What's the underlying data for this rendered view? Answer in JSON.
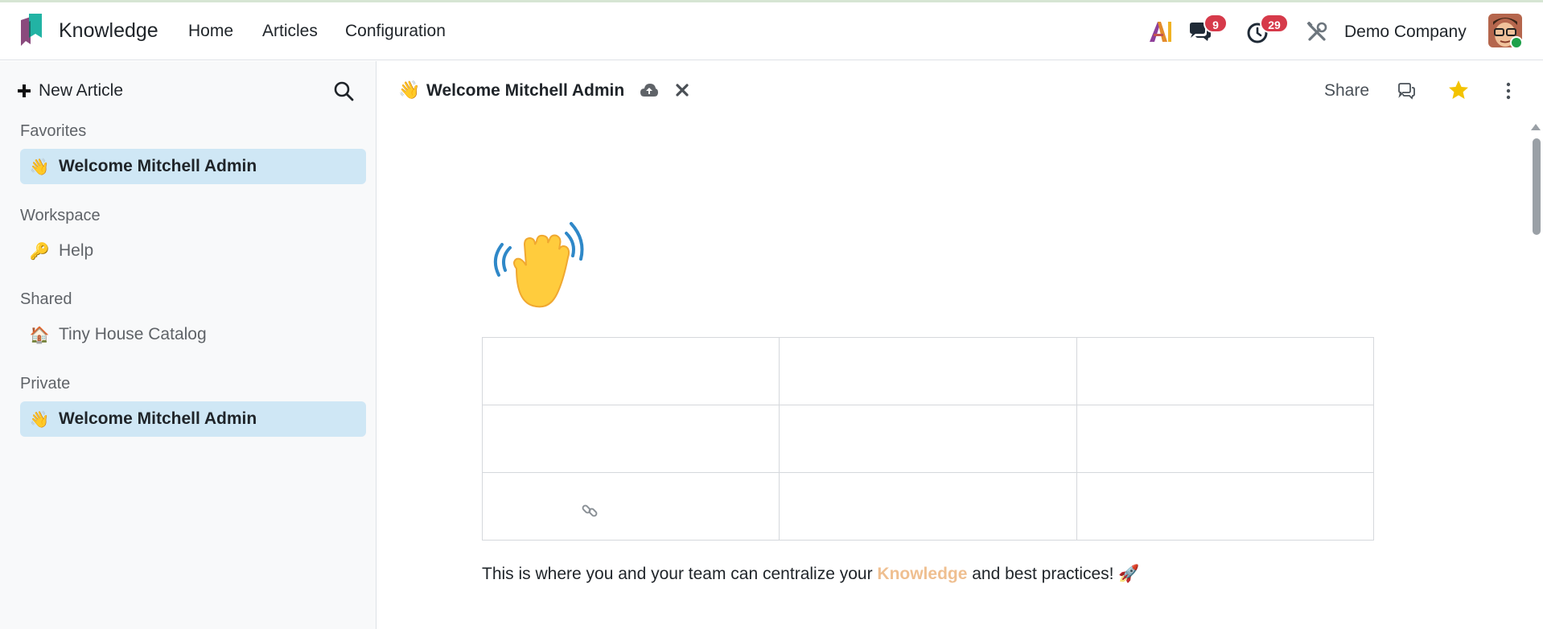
{
  "navbar": {
    "app_name": "Knowledge",
    "menu": [
      "Home",
      "Articles",
      "Configuration"
    ],
    "ai_icon": "ai-icon",
    "messages_count": "9",
    "activities_count": "29",
    "company": "Demo Company",
    "brand_color": "#1f8f86"
  },
  "sidebar": {
    "new_article_label": "New Article",
    "sections": {
      "favorites": {
        "title": "Favorites",
        "items": [
          {
            "emoji": "👋",
            "label": "Welcome Mitchell Admin"
          }
        ]
      },
      "workspace": {
        "title": "Workspace",
        "items": [
          {
            "emoji": "🔑",
            "label": "Help"
          }
        ]
      },
      "shared": {
        "title": "Shared",
        "items": [
          {
            "emoji": "🏠",
            "label": "Tiny House Catalog"
          }
        ]
      },
      "private": {
        "title": "Private",
        "items": [
          {
            "emoji": "👋",
            "label": "Welcome Mitchell Admin"
          }
        ]
      }
    },
    "active_color": "#cfe7f5"
  },
  "header": {
    "emoji": "👋",
    "title": "Welcome Mitchell Admin",
    "share_label": "Share",
    "favorite_color": "#f3c300"
  },
  "article": {
    "cover_emoji": "👋",
    "text_before": "This is where you and your team can centralize your ",
    "text_highlight": "Knowledge",
    "text_after": " and best practices! 🚀",
    "highlight_color": "#efbf90"
  }
}
